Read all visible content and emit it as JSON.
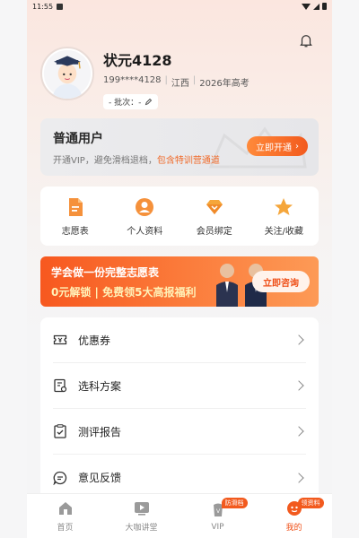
{
  "status": {
    "time": "11:55"
  },
  "profile": {
    "name": "状元4128",
    "phone": "199****4128",
    "province": "江西",
    "exam": "2026年高考",
    "batch": "- 批次：-"
  },
  "vip_card": {
    "title": "普通用户",
    "desc": "开通VIP，避免滑档退档，",
    "desc_highlight": "包含特训营通道",
    "button": "立即开通"
  },
  "quick_actions": [
    {
      "label": "志愿表",
      "icon": "document-icon"
    },
    {
      "label": "个人资料",
      "icon": "person-icon"
    },
    {
      "label": "会员绑定",
      "icon": "diamond-icon"
    },
    {
      "label": "关注/收藏",
      "icon": "star-icon"
    }
  ],
  "banner": {
    "line1": "学会做一份完整志愿表",
    "line2": "0元解锁 | 免费领5大高报福利",
    "button": "立即咨询"
  },
  "menu": [
    {
      "label": "优惠券",
      "icon": "coupon-icon"
    },
    {
      "label": "选科方案",
      "icon": "plan-icon"
    },
    {
      "label": "测评报告",
      "icon": "report-icon"
    },
    {
      "label": "意见反馈",
      "icon": "feedback-icon"
    }
  ],
  "tabs": [
    {
      "label": "首页",
      "icon": "home-icon",
      "badge": ""
    },
    {
      "label": "大咖讲堂",
      "icon": "video-icon",
      "badge": ""
    },
    {
      "label": "VIP",
      "icon": "vip-icon",
      "badge": "防滑档"
    },
    {
      "label": "我的",
      "icon": "me-icon",
      "badge": "领资料"
    }
  ],
  "colors": {
    "accent": "#f25a1e",
    "highlight": "#f06a2a"
  }
}
